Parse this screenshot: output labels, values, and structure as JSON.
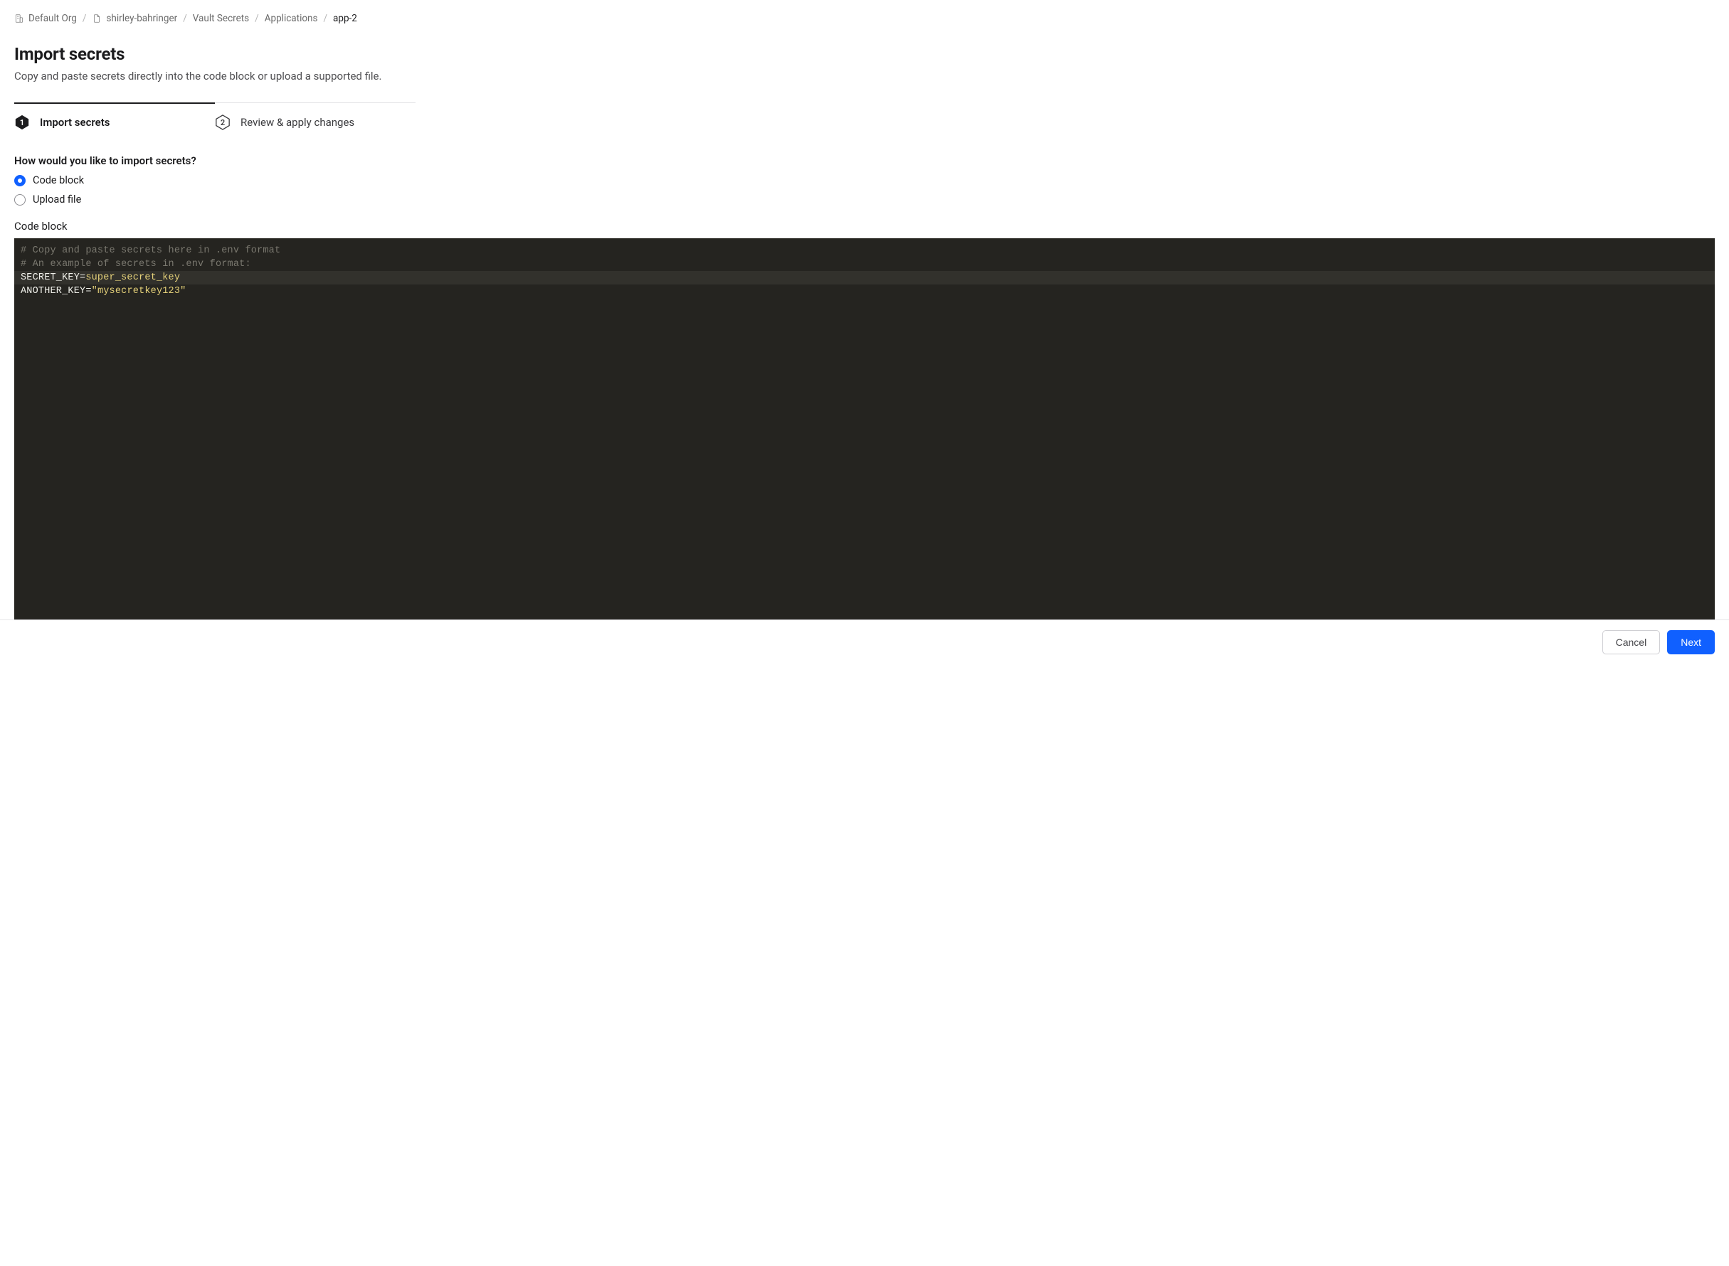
{
  "breadcrumb": {
    "org_label": "Default Org",
    "project_label": "shirley-bahringer",
    "service_label": "Vault Secrets",
    "section_label": "Applications",
    "current_label": "app-2"
  },
  "page": {
    "title": "Import secrets",
    "subtitle": "Copy and paste secrets directly into the code block or upload a supported file."
  },
  "stepper": {
    "step1_num": "1",
    "step1_label": "Import secrets",
    "step2_num": "2",
    "step2_label": "Review & apply changes"
  },
  "import_method": {
    "question": "How would you like to import secrets?",
    "opt_code_block": "Code block",
    "opt_upload_file": "Upload file"
  },
  "code_block": {
    "label": "Code block",
    "lines": [
      {
        "type": "comment",
        "text": "# Copy and paste secrets here in .env format"
      },
      {
        "type": "comment",
        "text": "# An example of secrets in .env format:"
      },
      {
        "type": "kv",
        "key": "SECRET_KEY",
        "op": "=",
        "value": "super_secret_key",
        "highlight": true
      },
      {
        "type": "kv",
        "key": "ANOTHER_KEY",
        "op": "=",
        "value": "\"mysecretkey123\""
      }
    ]
  },
  "footer": {
    "cancel_label": "Cancel",
    "next_label": "Next"
  }
}
